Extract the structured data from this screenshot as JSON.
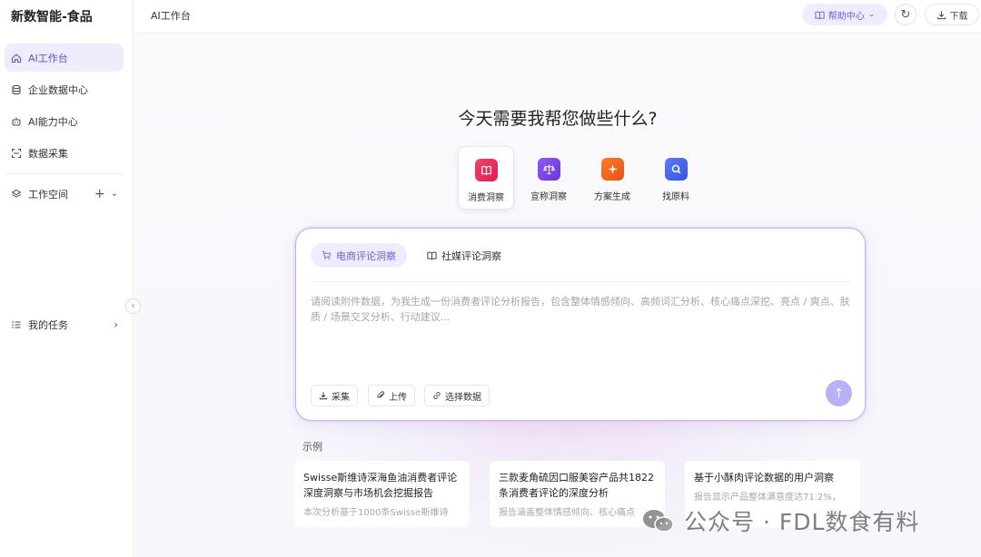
{
  "app": {
    "brand": "新数智能-食品"
  },
  "sidebar": {
    "items": [
      {
        "label": "AI工作台",
        "icon": "home-icon"
      },
      {
        "label": "企业数据中心",
        "icon": "database-icon"
      },
      {
        "label": "AI能力中心",
        "icon": "robot-icon"
      },
      {
        "label": "数据采集",
        "icon": "scan-icon"
      }
    ],
    "workspace": {
      "label": "工作空间",
      "icon": "layers-icon"
    },
    "tasks": {
      "label": "我的任务",
      "icon": "task-list-icon"
    }
  },
  "header": {
    "breadcrumb": "AI工作台",
    "help_label": "帮助中心",
    "download_label": "下载"
  },
  "main": {
    "headline": "今天需要我帮您做些什么?",
    "scenarios": [
      {
        "label": "消费洞察",
        "icon": "book-icon",
        "color": "#f0355b"
      },
      {
        "label": "宣称洞察",
        "icon": "scale-icon",
        "color": "#7b46ea"
      },
      {
        "label": "方案生成",
        "icon": "sparkle-icon",
        "color": "#f2611f"
      },
      {
        "label": "找原料",
        "icon": "search-icon",
        "color": "#4466f0"
      }
    ],
    "tabs": [
      {
        "label": "电商评论洞察",
        "icon": "cart-icon"
      },
      {
        "label": "社媒评论洞察",
        "icon": "book-open-icon"
      }
    ],
    "prompt_placeholder": "请阅读附件数据，为我生成一份消费者评论分析报告，包含整体情感倾向、高频词汇分析、核心痛点深挖、亮点 / 爽点、肤质 / 场景交叉分析、行动建议...",
    "actions": [
      {
        "label": "采集",
        "icon": "download-icon"
      },
      {
        "label": "上传",
        "icon": "paperclip-icon"
      },
      {
        "label": "选择数据",
        "icon": "link-icon"
      }
    ],
    "examples_label": "示例",
    "examples": [
      {
        "title": "Swisse斯维诗深海鱼油消费者评论深度洞察与市场机会挖掘报告",
        "desc": "本次分析基于1000条Swisse斯维诗"
      },
      {
        "title": "三款麦角硫因口服美容产品共1822条消费者评论的深度分析",
        "desc": "报告涵盖整体情感倾向、核心痛点"
      },
      {
        "title": "基于小酥肉评论数据的用户洞察",
        "desc": "报告显示产品整体满意度达71.2%，"
      }
    ]
  },
  "watermark": {
    "text": "公众号 · FDL数食有料"
  },
  "colors": {
    "accent": "#6a5ee0",
    "accent_bg": "#efedfd",
    "send": "#b7b1f6"
  }
}
